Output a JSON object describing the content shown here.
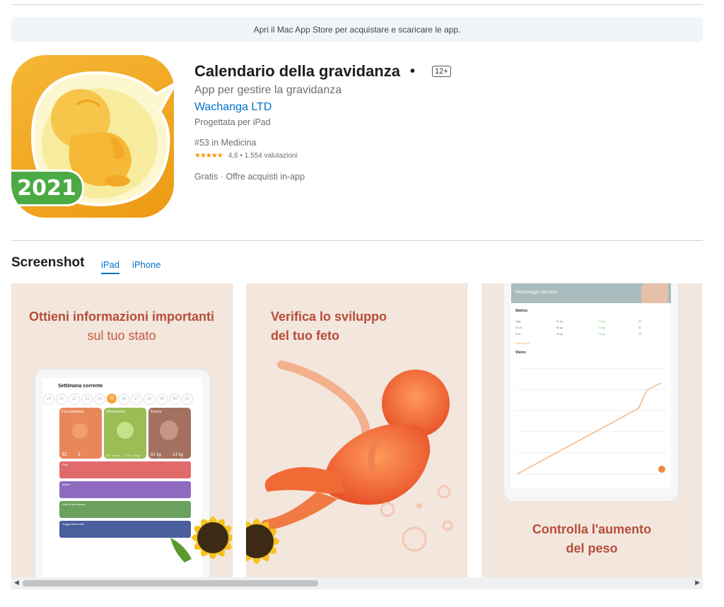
{
  "banner": {
    "text": "Apri il Mac App Store per acquistare e scaricare le app."
  },
  "app": {
    "icon_year": "2021",
    "title": "Calendario della gravidanza",
    "separator": "•",
    "age_rating": "12+",
    "subtitle": "App per gestire la gravidanza",
    "developer": "Wachanga LTD",
    "designed_for": "Progettata per iPad",
    "rank": "#53 in Medicina",
    "stars": "★★★★★",
    "rating_text": "4,6 • 1.554 valutazioni",
    "price_text": "Gratis · Offre acquisti in-app"
  },
  "screenshots": {
    "section_title": "Screenshot",
    "tabs": [
      {
        "label": "iPad"
      },
      {
        "label": "iPhone"
      }
    ],
    "items": [
      {
        "line1": "Ottieni informazioni importanti",
        "line2": "sul tuo stato",
        "tablet": {
          "title": "Settimana corrente",
          "weeks": [
            "20",
            "21",
            "22",
            "23",
            "24",
            "25",
            "26",
            "27",
            "28",
            "29",
            "30",
            "31"
          ],
          "cards": [
            {
              "label": "Il tuo bambino",
              "color": "#e8875a"
            },
            {
              "label": "Dimensione",
              "color": "#9bbd54"
            },
            {
              "label": "Pancia",
              "color": "#a4705f"
            }
          ],
          "card_values": [
            "32",
            "2",
            "30 - 35 cm",
            "0,5 - 0,8 kg",
            "81 kg",
            "14 kg"
          ],
          "rows": [
            {
              "label": "Feto",
              "color": "#e26a6a"
            },
            {
              "label": "Madre",
              "color": "#8e6bbf"
            },
            {
              "label": "Stile di gravidanza",
              "color": "#6aa15f"
            },
            {
              "label": "Suggerimenti utili",
              "color": "#4a5e9c"
            }
          ]
        }
      },
      {
        "line1": "Verifica lo sviluppo",
        "line2": "del tuo feto"
      },
      {
        "line1": "Controlla l'aumento",
        "line2": "del peso",
        "tablet": {
          "header": "Monitoraggio del peso",
          "history": "Storico",
          "rows": [
            {
              "c1": "Oggi",
              "c2": "81 kg",
              "c3": "+14 kg",
              "c4": "32"
            },
            {
              "c1": "20 ott",
              "c2": "80 kg",
              "c3": "+13 kg",
              "c4": "31"
            },
            {
              "c1": "8 ott",
              "c2": "78 kg",
              "c3": "+11 kg",
              "c4": "29"
            }
          ],
          "more": "Mostra di più",
          "visual": "Visivo"
        }
      }
    ]
  }
}
